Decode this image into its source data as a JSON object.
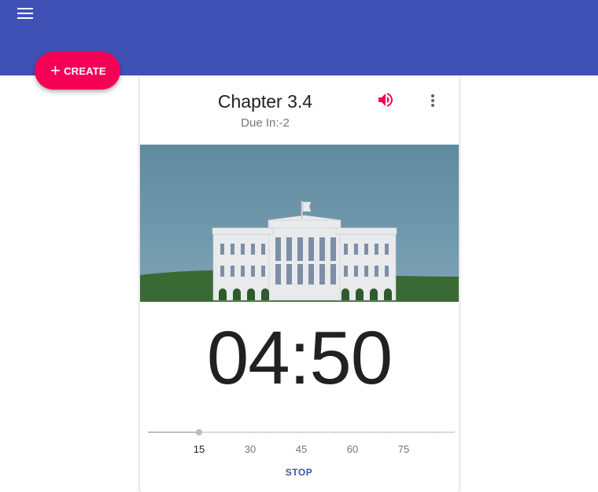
{
  "appbar": {
    "color": "#3f51b5",
    "menu_icon": "menu-icon"
  },
  "create": {
    "label": "CREATE",
    "icon": "plus-icon",
    "color": "#f50057"
  },
  "card": {
    "title": "Chapter 3.4",
    "due": "Due In:-2",
    "volume_icon": "volume-up-icon",
    "more_icon": "more-vert-icon",
    "timer": "04:50",
    "slider": {
      "value": 15,
      "min": 0,
      "max": 90,
      "step": 5,
      "ticks": [
        "15",
        "30",
        "45",
        "60",
        "75"
      ]
    },
    "stop_label": "STOP"
  }
}
